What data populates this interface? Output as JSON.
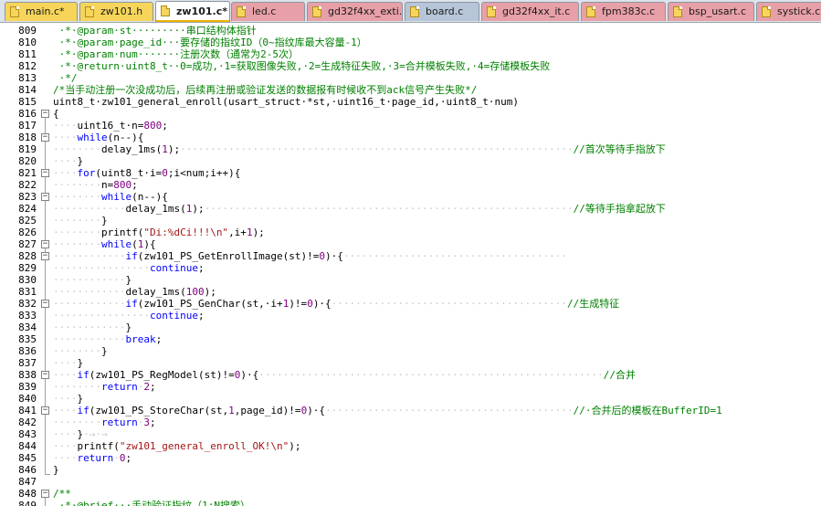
{
  "tabs": [
    {
      "label": "main.c*",
      "active": false
    },
    {
      "label": "zw101.h",
      "active": false
    },
    {
      "label": "zw101.c*",
      "active": true
    },
    {
      "label": "led.c",
      "active": false
    },
    {
      "label": "gd32f4xx_exti.c",
      "active": false
    },
    {
      "label": "board.c",
      "active": false
    },
    {
      "label": "gd32f4xx_it.c",
      "active": false
    },
    {
      "label": "fpm383c.c",
      "active": false
    },
    {
      "label": "bsp_usart.c",
      "active": false
    },
    {
      "label": "systick.c",
      "active": false
    }
  ],
  "colors": {
    "keyword": "#0000ff",
    "comment": "#008000",
    "string": "#a31515",
    "number": "#800080",
    "whitespace_marker": "#c8c8c8",
    "active_tab_accent": "#f0b400"
  },
  "lines": [
    {
      "no": "809",
      "fold": "",
      "tokens": [
        {
          "t": " ·*·@param·st·········串口结构体指针",
          "c": "cm"
        }
      ]
    },
    {
      "no": "810",
      "fold": "",
      "tokens": [
        {
          "t": " ·*·@param·page_id···要存储的指纹ID（0~指纹库最大容量-1）",
          "c": "cm"
        }
      ]
    },
    {
      "no": "811",
      "fold": "",
      "tokens": [
        {
          "t": " ·*·@param·num·······注册次数（通常为2-5次）",
          "c": "cm"
        }
      ]
    },
    {
      "no": "812",
      "fold": "",
      "tokens": [
        {
          "t": " ·*·@return·uint8_t··0=成功,·1=获取图像失败,·2=生成特征失败,·3=合并模板失败,·4=存储模板失败",
          "c": "cm"
        }
      ]
    },
    {
      "no": "813",
      "fold": "",
      "tokens": [
        {
          "t": " ·*/",
          "c": "cm"
        }
      ]
    },
    {
      "no": "814",
      "fold": "",
      "tokens": [
        {
          "t": "/*当手动注册一次没成功后，后续再注册或验证发送的数据报有时候收不到ack信号产生失败*/",
          "c": "cm"
        }
      ]
    },
    {
      "no": "815",
      "fold": "",
      "tokens": [
        {
          "t": "uint8_t·zw101_general_enroll(usart_struct·*st,·uint16_t·page_id,·uint8_t·num)",
          "c": ""
        }
      ]
    },
    {
      "no": "816",
      "fold": "minus",
      "tokens": [
        {
          "t": "{",
          "c": ""
        }
      ]
    },
    {
      "no": "817",
      "fold": "",
      "tokens": [
        {
          "t": "····",
          "c": "ws"
        },
        {
          "t": "uint16_t·n=",
          "c": ""
        },
        {
          "t": "800",
          "c": "num"
        },
        {
          "t": ";",
          "c": ""
        }
      ]
    },
    {
      "no": "818",
      "fold": "minus",
      "tokens": [
        {
          "t": "····",
          "c": "ws"
        },
        {
          "t": "while",
          "c": "kw"
        },
        {
          "t": "(n--){",
          "c": ""
        }
      ]
    },
    {
      "no": "819",
      "fold": "",
      "tokens": [
        {
          "t": "········",
          "c": "ws"
        },
        {
          "t": "delay_1ms(",
          "c": ""
        },
        {
          "t": "1",
          "c": "num"
        },
        {
          "t": ");",
          "c": ""
        },
        {
          "t": "·································································",
          "c": "ws"
        },
        {
          "t": "//首次等待手指放下",
          "c": "cm"
        }
      ]
    },
    {
      "no": "820",
      "fold": "",
      "tokens": [
        {
          "t": "····",
          "c": "ws"
        },
        {
          "t": "}",
          "c": ""
        }
      ]
    },
    {
      "no": "821",
      "fold": "minus",
      "tokens": [
        {
          "t": "····",
          "c": "ws"
        },
        {
          "t": "for",
          "c": "kw"
        },
        {
          "t": "(uint8_t·i=",
          "c": ""
        },
        {
          "t": "0",
          "c": "num"
        },
        {
          "t": ";i<num;i++){",
          "c": ""
        }
      ]
    },
    {
      "no": "822",
      "fold": "",
      "tokens": [
        {
          "t": "········",
          "c": "ws"
        },
        {
          "t": "n=",
          "c": ""
        },
        {
          "t": "800",
          "c": "num"
        },
        {
          "t": ";",
          "c": ""
        }
      ]
    },
    {
      "no": "823",
      "fold": "minus",
      "tokens": [
        {
          "t": "········",
          "c": "ws"
        },
        {
          "t": "while",
          "c": "kw"
        },
        {
          "t": "(n--){",
          "c": ""
        }
      ]
    },
    {
      "no": "824",
      "fold": "",
      "tokens": [
        {
          "t": "············",
          "c": "ws"
        },
        {
          "t": "delay_1ms(",
          "c": ""
        },
        {
          "t": "1",
          "c": "num"
        },
        {
          "t": ");",
          "c": ""
        },
        {
          "t": "·····························································",
          "c": "ws"
        },
        {
          "t": "//等待手指拿起放下",
          "c": "cm"
        }
      ]
    },
    {
      "no": "825",
      "fold": "",
      "tokens": [
        {
          "t": "········",
          "c": "ws"
        },
        {
          "t": "}",
          "c": ""
        }
      ]
    },
    {
      "no": "826",
      "fold": "",
      "tokens": [
        {
          "t": "········",
          "c": "ws"
        },
        {
          "t": "printf(",
          "c": ""
        },
        {
          "t": "\"Di:%dCi!!!\\n\"",
          "c": "str"
        },
        {
          "t": ",i+",
          "c": ""
        },
        {
          "t": "1",
          "c": "num"
        },
        {
          "t": ");",
          "c": ""
        }
      ]
    },
    {
      "no": "827",
      "fold": "minus",
      "tokens": [
        {
          "t": "········",
          "c": "ws"
        },
        {
          "t": "while",
          "c": "kw"
        },
        {
          "t": "(",
          "c": ""
        },
        {
          "t": "1",
          "c": "num"
        },
        {
          "t": "){",
          "c": ""
        }
      ]
    },
    {
      "no": "828",
      "fold": "minus",
      "tokens": [
        {
          "t": "············",
          "c": "ws"
        },
        {
          "t": "if",
          "c": "kw"
        },
        {
          "t": "(zw101_PS_GetEnrollImage(st)!=",
          "c": ""
        },
        {
          "t": "0",
          "c": "num"
        },
        {
          "t": ")·{",
          "c": ""
        },
        {
          "t": "·····································",
          "c": "ws"
        }
      ]
    },
    {
      "no": "829",
      "fold": "",
      "tokens": [
        {
          "t": "················",
          "c": "ws"
        },
        {
          "t": "continue",
          "c": "kw"
        },
        {
          "t": ";",
          "c": ""
        }
      ]
    },
    {
      "no": "830",
      "fold": "",
      "tokens": [
        {
          "t": "············",
          "c": "ws"
        },
        {
          "t": "}",
          "c": ""
        }
      ]
    },
    {
      "no": "831",
      "fold": "",
      "tokens": [
        {
          "t": "············",
          "c": "ws"
        },
        {
          "t": "delay_1ms(",
          "c": ""
        },
        {
          "t": "100",
          "c": "num"
        },
        {
          "t": ");",
          "c": ""
        }
      ]
    },
    {
      "no": "832",
      "fold": "minus",
      "tokens": [
        {
          "t": "············",
          "c": "ws"
        },
        {
          "t": "if",
          "c": "kw"
        },
        {
          "t": "(zw101_PS_GenChar(st,·i+",
          "c": ""
        },
        {
          "t": "1",
          "c": "num"
        },
        {
          "t": ")!=",
          "c": ""
        },
        {
          "t": "0",
          "c": "num"
        },
        {
          "t": ")·{",
          "c": ""
        },
        {
          "t": "·······································",
          "c": "ws"
        },
        {
          "t": "//生成特征",
          "c": "cm"
        }
      ]
    },
    {
      "no": "833",
      "fold": "",
      "tokens": [
        {
          "t": "················",
          "c": "ws"
        },
        {
          "t": "continue",
          "c": "kw"
        },
        {
          "t": ";",
          "c": ""
        }
      ]
    },
    {
      "no": "834",
      "fold": "",
      "tokens": [
        {
          "t": "············",
          "c": "ws"
        },
        {
          "t": "}",
          "c": ""
        }
      ]
    },
    {
      "no": "835",
      "fold": "",
      "tokens": [
        {
          "t": "············",
          "c": "ws"
        },
        {
          "t": "break",
          "c": "kw"
        },
        {
          "t": ";",
          "c": ""
        }
      ]
    },
    {
      "no": "836",
      "fold": "",
      "tokens": [
        {
          "t": "········",
          "c": "ws"
        },
        {
          "t": "}",
          "c": ""
        }
      ]
    },
    {
      "no": "837",
      "fold": "",
      "tokens": [
        {
          "t": "····",
          "c": "ws"
        },
        {
          "t": "}",
          "c": ""
        }
      ]
    },
    {
      "no": "838",
      "fold": "minus",
      "tokens": [
        {
          "t": "····",
          "c": "ws"
        },
        {
          "t": "if",
          "c": "kw"
        },
        {
          "t": "(zw101_PS_RegModel(st)!=",
          "c": ""
        },
        {
          "t": "0",
          "c": "num"
        },
        {
          "t": ")·{",
          "c": ""
        },
        {
          "t": "·························································",
          "c": "ws"
        },
        {
          "t": "//合并",
          "c": "cm"
        }
      ]
    },
    {
      "no": "839",
      "fold": "",
      "tokens": [
        {
          "t": "········",
          "c": "ws"
        },
        {
          "t": "return",
          "c": "kw"
        },
        {
          "t": "·",
          "c": "ws"
        },
        {
          "t": "2",
          "c": "num"
        },
        {
          "t": ";",
          "c": ""
        }
      ]
    },
    {
      "no": "840",
      "fold": "",
      "tokens": [
        {
          "t": "····",
          "c": "ws"
        },
        {
          "t": "}",
          "c": ""
        }
      ]
    },
    {
      "no": "841",
      "fold": "minus",
      "tokens": [
        {
          "t": "····",
          "c": "ws"
        },
        {
          "t": "if",
          "c": "kw"
        },
        {
          "t": "(zw101_PS_StoreChar(st,",
          "c": ""
        },
        {
          "t": "1",
          "c": "num"
        },
        {
          "t": ",page_id)!=",
          "c": ""
        },
        {
          "t": "0",
          "c": "num"
        },
        {
          "t": ")·{",
          "c": ""
        },
        {
          "t": "·········································",
          "c": "ws"
        },
        {
          "t": "//·合并后的模板在BufferID=1",
          "c": "cm"
        }
      ]
    },
    {
      "no": "842",
      "fold": "",
      "tokens": [
        {
          "t": "········",
          "c": "ws"
        },
        {
          "t": "return",
          "c": "kw"
        },
        {
          "t": "·",
          "c": "ws"
        },
        {
          "t": "3",
          "c": "num"
        },
        {
          "t": ";",
          "c": ""
        }
      ]
    },
    {
      "no": "843",
      "fold": "",
      "tokens": [
        {
          "t": "····",
          "c": "ws"
        },
        {
          "t": "}",
          "c": ""
        },
        {
          "t": "·→·→",
          "c": "ws"
        }
      ]
    },
    {
      "no": "844",
      "fold": "",
      "tokens": [
        {
          "t": "····",
          "c": "ws"
        },
        {
          "t": "printf(",
          "c": ""
        },
        {
          "t": "\"zw101_general_enroll_OK!\\n\"",
          "c": "str"
        },
        {
          "t": ");",
          "c": ""
        }
      ]
    },
    {
      "no": "845",
      "fold": "",
      "tokens": [
        {
          "t": "····",
          "c": "ws"
        },
        {
          "t": "return",
          "c": "kw"
        },
        {
          "t": "·",
          "c": "ws"
        },
        {
          "t": "0",
          "c": "num"
        },
        {
          "t": ";",
          "c": ""
        }
      ]
    },
    {
      "no": "846",
      "fold": "",
      "tokens": [
        {
          "t": "}",
          "c": ""
        }
      ]
    },
    {
      "no": "847",
      "fold": "",
      "tokens": []
    },
    {
      "no": "848",
      "fold": "minus",
      "tokens": [
        {
          "t": "/**",
          "c": "cm"
        }
      ]
    },
    {
      "no": "849",
      "fold": "",
      "tokens": [
        {
          "t": " ·*·@brief···手动验证指纹（1:N搜索）",
          "c": "cm"
        }
      ]
    }
  ]
}
